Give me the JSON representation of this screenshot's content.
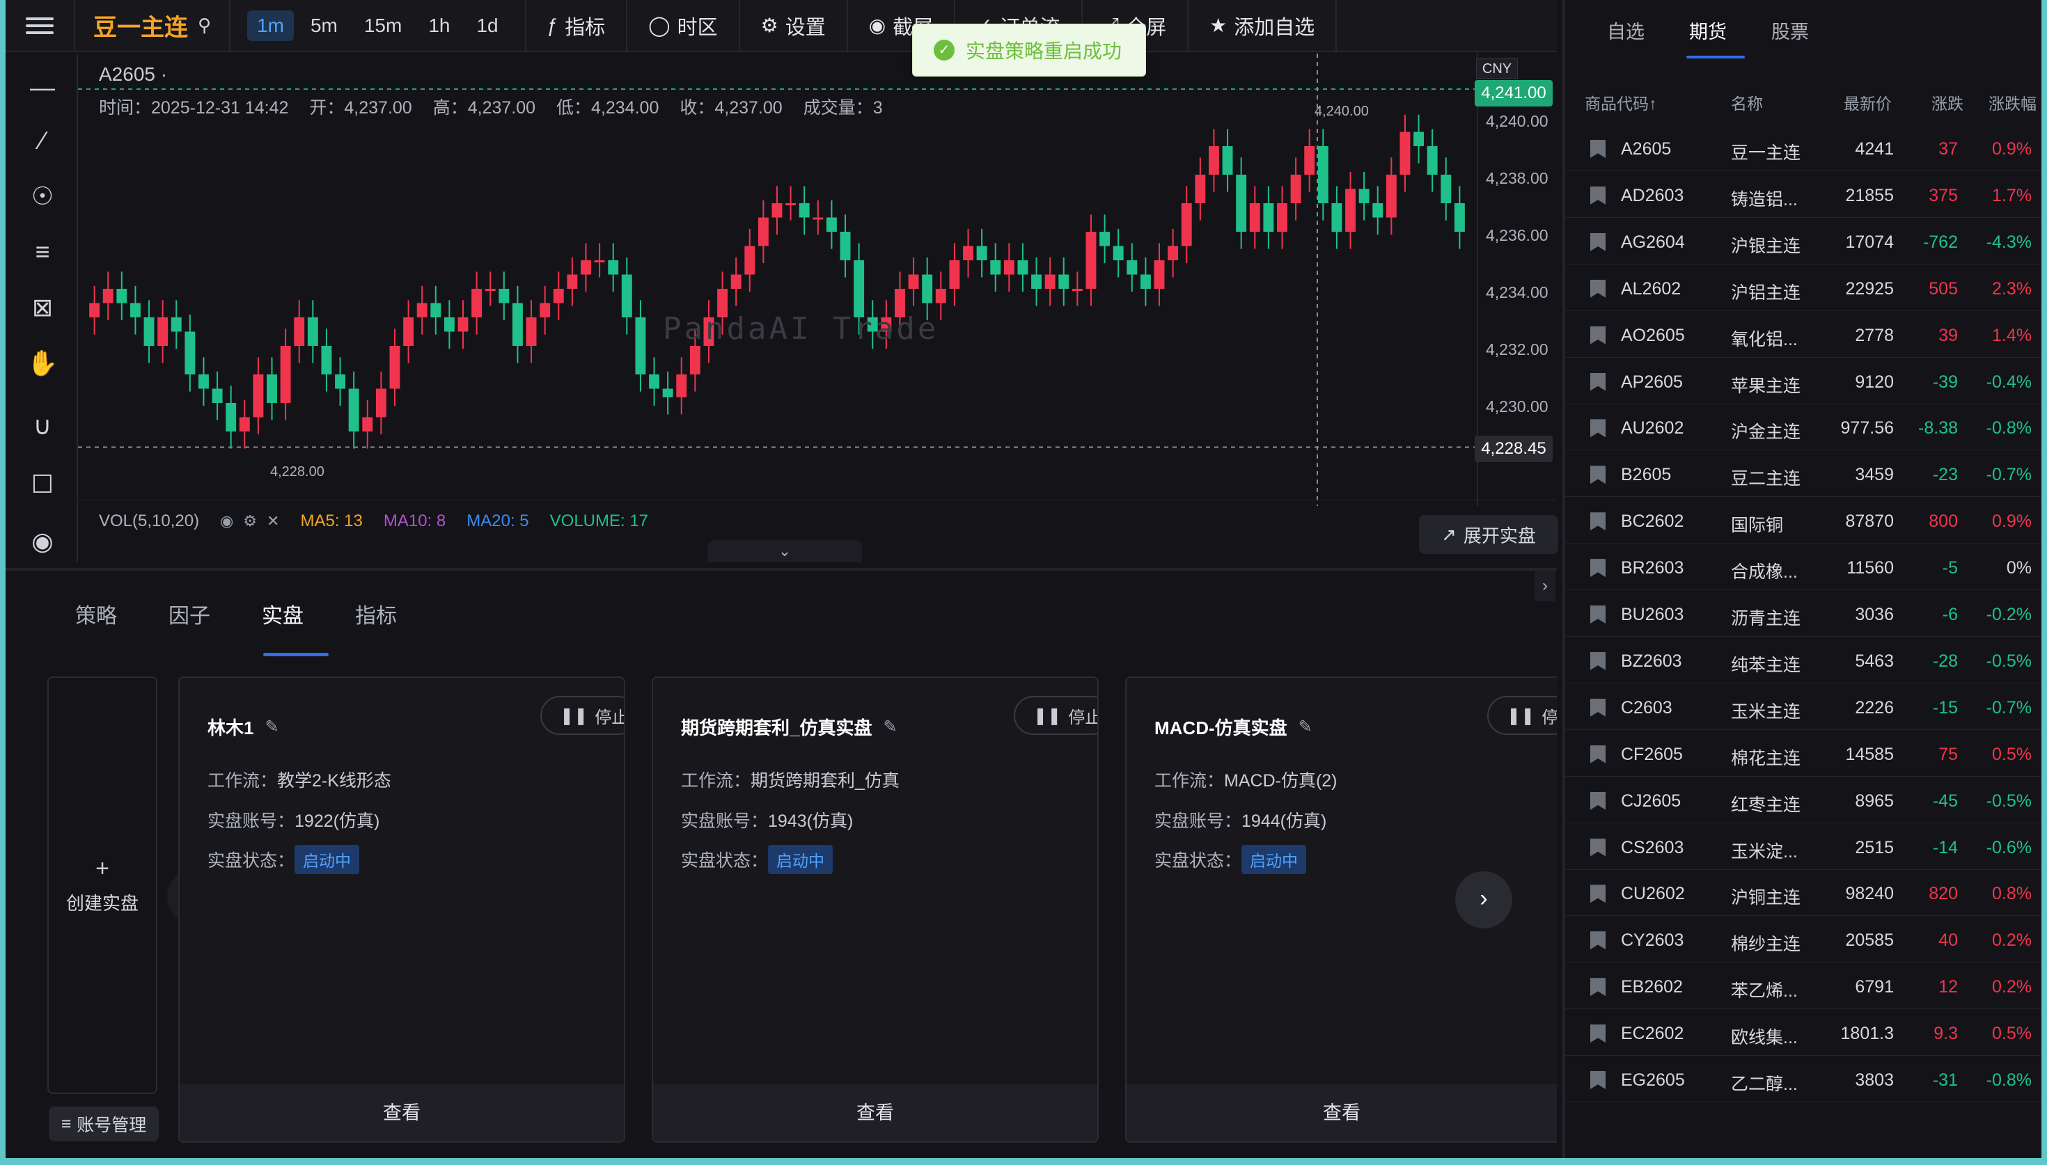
{
  "toolbar": {
    "symbol_name": "豆一主连",
    "intervals": [
      "1m",
      "5m",
      "15m",
      "1h",
      "1d"
    ],
    "active_interval": "1m",
    "indicator_label": "指标",
    "timezone_label": "时区",
    "settings_label": "设置",
    "screenshot_label": "截屏",
    "order_label": "订单流",
    "fullscreen_label": "全屏",
    "add_watch_label": "添加自选"
  },
  "toast": {
    "message": "实盘策略重启成功"
  },
  "chart": {
    "symbol": "A2605 ·",
    "ohlc": {
      "time": "时间：2025-12-31 14:42",
      "open": "开：4,237.00",
      "high": "高：4,237.00",
      "low": "低：4,234.00",
      "close": "收：4,237.00",
      "volume": "成交量：3"
    },
    "currency": "CNY",
    "last_price_tag": "4,241.00",
    "crosshair_price_tag": "4,228.45",
    "y_ticks": [
      "4,240.00",
      "4,238.00",
      "4,236.00",
      "4,234.00",
      "4,232.00",
      "4,230.00"
    ],
    "high_mark": "4,240.00",
    "low_mark": "4,228.00",
    "watermark": "PandaAI Trade"
  },
  "volume_bar": {
    "label": "VOL(5,10,20)",
    "ma5": "MA5: 13",
    "ma10": "MA10: 8",
    "ma20": "MA20: 5",
    "volume": "VOLUME: 17"
  },
  "expand_button": "展开实盘",
  "bottom": {
    "tabs": [
      "策略",
      "因子",
      "实盘",
      "指标"
    ],
    "active_tab": "实盘",
    "create_label": "创建实盘",
    "account_label": "账号管理",
    "cards": [
      {
        "title": "林木1",
        "stop": "停止",
        "workflow_label": "工作流：",
        "workflow": "教学2-K线形态",
        "account_label": "实盘账号：",
        "account": "1922(仿真)",
        "status_label": "实盘状态：",
        "status": "启动中",
        "view": "查看"
      },
      {
        "title": "期货跨期套利_仿真实盘",
        "stop": "停止",
        "workflow_label": "工作流：",
        "workflow": "期货跨期套利_仿真",
        "account_label": "实盘账号：",
        "account": "1943(仿真)",
        "status_label": "实盘状态：",
        "status": "启动中",
        "view": "查看"
      },
      {
        "title": "MACD-仿真实盘",
        "stop": "停止",
        "workflow_label": "工作流：",
        "workflow": "MACD-仿真(2)",
        "account_label": "实盘账号：",
        "account": "1944(仿真)",
        "status_label": "实盘状态：",
        "status": "启动中",
        "view": "查看"
      }
    ]
  },
  "watchlist": {
    "tabs": [
      "自选",
      "期货",
      "股票"
    ],
    "active_tab": "期货",
    "headers": {
      "code": "商品代码↑",
      "name": "名称",
      "price": "最新价",
      "chg": "涨跌",
      "pct": "涨跌幅"
    },
    "rows": [
      {
        "code": "A2605",
        "name": "豆一主连",
        "price": "4241",
        "chg": "37",
        "pct": "0.9%",
        "dir": "up"
      },
      {
        "code": "AD2603",
        "name": "铸造铝...",
        "price": "21855",
        "chg": "375",
        "pct": "1.7%",
        "dir": "up"
      },
      {
        "code": "AG2604",
        "name": "沪银主连",
        "price": "17074",
        "chg": "-762",
        "pct": "-4.3%",
        "dir": "dn"
      },
      {
        "code": "AL2602",
        "name": "沪铝主连",
        "price": "22925",
        "chg": "505",
        "pct": "2.3%",
        "dir": "up"
      },
      {
        "code": "AO2605",
        "name": "氧化铝...",
        "price": "2778",
        "chg": "39",
        "pct": "1.4%",
        "dir": "up"
      },
      {
        "code": "AP2605",
        "name": "苹果主连",
        "price": "9120",
        "chg": "-39",
        "pct": "-0.4%",
        "dir": "dn"
      },
      {
        "code": "AU2602",
        "name": "沪金主连",
        "price": "977.56",
        "chg": "-8.38",
        "pct": "-0.8%",
        "dir": "dn"
      },
      {
        "code": "B2605",
        "name": "豆二主连",
        "price": "3459",
        "chg": "-23",
        "pct": "-0.7%",
        "dir": "dn"
      },
      {
        "code": "BC2602",
        "name": "国际铜",
        "price": "87870",
        "chg": "800",
        "pct": "0.9%",
        "dir": "up"
      },
      {
        "code": "BR2603",
        "name": "合成橡...",
        "price": "11560",
        "chg": "-5",
        "pct": "0%",
        "dir": "dn"
      },
      {
        "code": "BU2603",
        "name": "沥青主连",
        "price": "3036",
        "chg": "-6",
        "pct": "-0.2%",
        "dir": "dn"
      },
      {
        "code": "BZ2603",
        "name": "纯苯主连",
        "price": "5463",
        "chg": "-28",
        "pct": "-0.5%",
        "dir": "dn"
      },
      {
        "code": "C2603",
        "name": "玉米主连",
        "price": "2226",
        "chg": "-15",
        "pct": "-0.7%",
        "dir": "dn"
      },
      {
        "code": "CF2605",
        "name": "棉花主连",
        "price": "14585",
        "chg": "75",
        "pct": "0.5%",
        "dir": "up"
      },
      {
        "code": "CJ2605",
        "name": "红枣主连",
        "price": "8965",
        "chg": "-45",
        "pct": "-0.5%",
        "dir": "dn"
      },
      {
        "code": "CS2603",
        "name": "玉米淀...",
        "price": "2515",
        "chg": "-14",
        "pct": "-0.6%",
        "dir": "dn"
      },
      {
        "code": "CU2602",
        "name": "沪铜主连",
        "price": "98240",
        "chg": "820",
        "pct": "0.8%",
        "dir": "up"
      },
      {
        "code": "CY2603",
        "name": "棉纱主连",
        "price": "20585",
        "chg": "40",
        "pct": "0.2%",
        "dir": "up"
      },
      {
        "code": "EB2602",
        "name": "苯乙烯...",
        "price": "6791",
        "chg": "12",
        "pct": "0.2%",
        "dir": "up"
      },
      {
        "code": "EC2602",
        "name": "欧线集...",
        "price": "1801.3",
        "chg": "9.3",
        "pct": "0.5%",
        "dir": "up"
      },
      {
        "code": "EG2605",
        "name": "乙二醇...",
        "price": "3803",
        "chg": "-31",
        "pct": "-0.8%",
        "dir": "dn"
      }
    ]
  },
  "colors": {
    "up": "#f0344e",
    "down": "#1fc08a",
    "accent": "#2f6fe8",
    "brand": "#f5a524"
  }
}
